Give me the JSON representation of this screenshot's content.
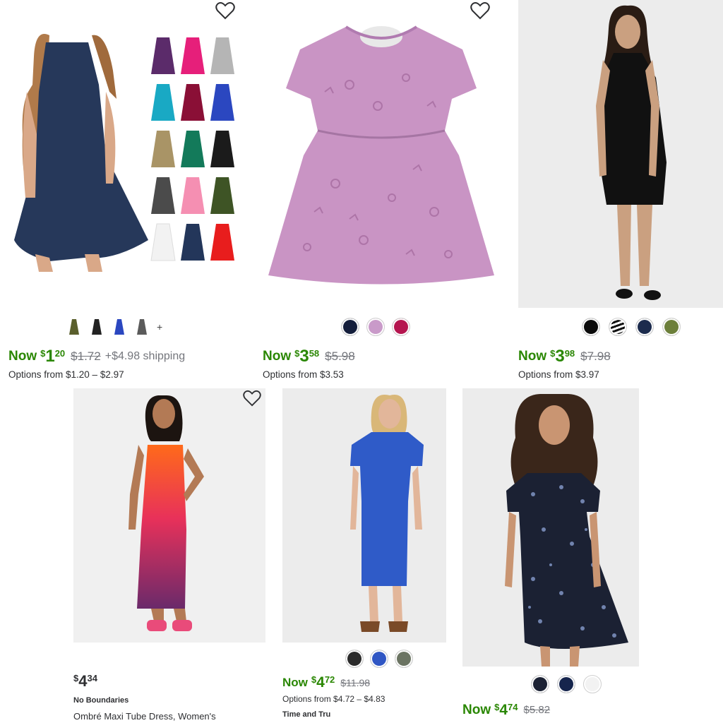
{
  "products": [
    {
      "id": "p1",
      "image": "Navy sleeveless swing dress with color variant grid",
      "variant_thumbs": [
        "olive",
        "black",
        "blue",
        "gray"
      ],
      "more_label": "+",
      "now_label": "Now",
      "currency": "$",
      "dollars": "1",
      "cents": "20",
      "was_price": "$1.72",
      "shipping": "+$4.98 shipping",
      "options": "Options from $1.20 – $2.97",
      "favorite": false
    },
    {
      "id": "p2",
      "image": "Lilac printed short-sleeve girls dress",
      "swatches": [
        "#141e3c",
        "#c99ac9",
        "#b5154f"
      ],
      "now_label": "Now",
      "currency": "$",
      "dollars": "3",
      "cents": "58",
      "was_price": "$5.98",
      "options": "Options from $3.53",
      "favorite": false
    },
    {
      "id": "p3",
      "image": "Black sleeveless knee-length dress",
      "swatches": [
        "#0b0b0b",
        "stripe",
        "#1c2b4d",
        "#6c7f3a"
      ],
      "now_label": "Now",
      "currency": "$",
      "dollars": "3",
      "cents": "98",
      "was_price": "$7.98",
      "options": "Options from $3.97"
    },
    {
      "id": "p4",
      "image": "Orange to purple ombre maxi tube dress",
      "currency": "$",
      "dollars": "4",
      "cents": "34",
      "brand": "No Boundaries",
      "title": "Ombré Maxi Tube Dress, Women's",
      "favorite": false
    },
    {
      "id": "p5",
      "image": "Royal blue short-sleeve midi dress",
      "swatches": [
        "#2b2b2b",
        "#2f56c4",
        "#6b7462"
      ],
      "now_label": "Now",
      "currency": "$",
      "dollars": "4",
      "cents": "72",
      "was_price": "$11.98",
      "options": "Options from $4.72 – $4.83",
      "brand": "Time and Tru"
    },
    {
      "id": "p6",
      "image": "Navy floral print girls dress",
      "swatches": [
        "#1b2133",
        "#16254d",
        "#f2f2f2"
      ],
      "now_label": "Now",
      "currency": "$",
      "dollars": "4",
      "cents": "74",
      "was_price": "$5.82"
    }
  ]
}
